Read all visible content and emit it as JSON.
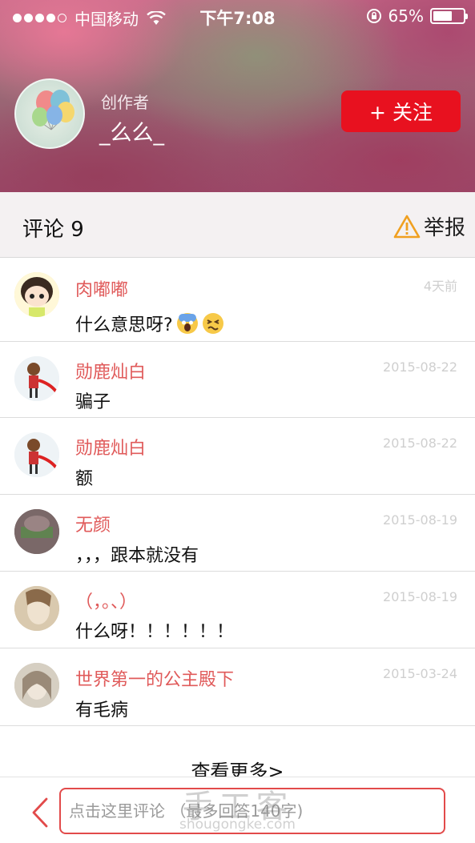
{
  "status_bar": {
    "carrier": "中国移动",
    "time": "下午7:08",
    "battery_percent": "65%",
    "battery_level": 0.65,
    "signal_bars_filled": 4
  },
  "profile": {
    "creator_label": "创作者",
    "creator_name": "_么么_",
    "follow_label": "+ 关注"
  },
  "comments_section": {
    "title": "评论 9",
    "report_label": "举报"
  },
  "comments": [
    {
      "name": "肉嘟嘟",
      "time": "4天前",
      "text": "什么意思呀?"
    },
    {
      "name": "勋鹿灿白",
      "time": "2015-08-22",
      "text": "骗子"
    },
    {
      "name": "勋鹿灿白",
      "time": "2015-08-22",
      "text": "额"
    },
    {
      "name": "无颜",
      "time": "2015-08-19",
      "text": "，，，跟本就没有"
    },
    {
      "name": "（，。、）",
      "time": "2015-08-19",
      "text": "什么呀！！！！！！"
    },
    {
      "name": "世界第一的公主殿下",
      "time": "2015-03-24",
      "text": "有毛病"
    }
  ],
  "see_more": "查看更多>",
  "comment_input": {
    "placeholder": "点击这里评论 （最多回答140字)"
  },
  "watermark": {
    "cn": "手工客",
    "en": "shougongke.com"
  },
  "colors": {
    "accent_red": "#e8111f",
    "name_red": "#e05a5a"
  }
}
